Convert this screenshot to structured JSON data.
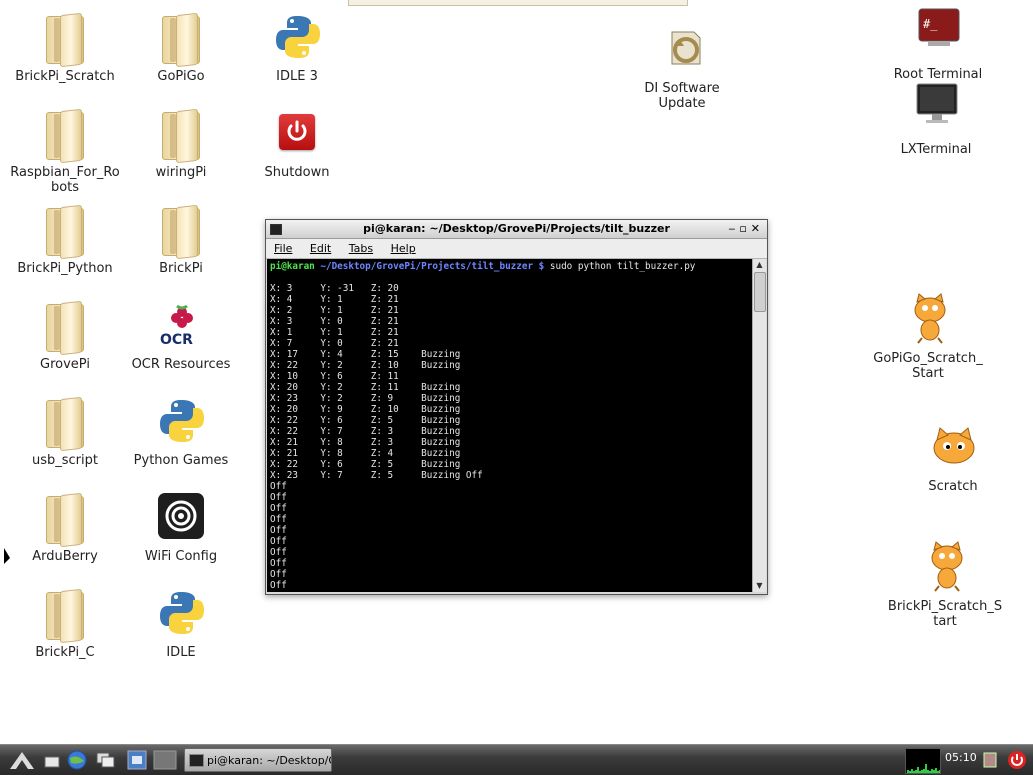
{
  "desktop": {
    "icons": [
      {
        "label": "BrickPi_Scratch",
        "type": "folder"
      },
      {
        "label": "GoPiGo",
        "type": "folder"
      },
      {
        "label": "IDLE 3",
        "type": "python"
      },
      {
        "label": "DI Software Update",
        "type": "update"
      },
      {
        "label": "Root Terminal",
        "type": "root-terminal"
      },
      {
        "label": "Raspbian_For_Robots",
        "type": "folder"
      },
      {
        "label": "wiringPi",
        "type": "folder"
      },
      {
        "label": "Shutdown",
        "type": "shutdown"
      },
      {
        "label": "LXTerminal",
        "type": "monitor"
      },
      {
        "label": "BrickPi_Python",
        "type": "folder"
      },
      {
        "label": "BrickPi",
        "type": "folder"
      },
      {
        "label": "GrovePi",
        "type": "folder"
      },
      {
        "label": "OCR Resources",
        "type": "ocr"
      },
      {
        "label": "GoPiGo_Scratch_Start",
        "type": "scratch-cat"
      },
      {
        "label": "usb_script",
        "type": "folder"
      },
      {
        "label": "Python Games",
        "type": "python"
      },
      {
        "label": "Scratch",
        "type": "scratch"
      },
      {
        "label": "ArduBerry",
        "type": "folder"
      },
      {
        "label": "WiFi Config",
        "type": "wifi"
      },
      {
        "label": "BrickPi_Scratch_Start",
        "type": "scratch-cat"
      },
      {
        "label": "BrickPi_C",
        "type": "folder"
      },
      {
        "label": "IDLE",
        "type": "python"
      }
    ]
  },
  "terminal": {
    "title": "pi@karan: ~/Desktop/GrovePi/Projects/tilt_buzzer",
    "menu": [
      "File",
      "Edit",
      "Tabs",
      "Help"
    ],
    "prompt_user": "pi@karan",
    "prompt_path": " ~/Desktop/GrovePi/Projects/tilt_buzzer $",
    "command": " sudo python tilt_buzzer.py",
    "lines": [
      "",
      "X: 3     Y: -31   Z: 20",
      "X: 4     Y: 1     Z: 21",
      "X: 2     Y: 1     Z: 21",
      "X: 3     Y: 0     Z: 21",
      "X: 1     Y: 1     Z: 21",
      "X: 7     Y: 0     Z: 21",
      "X: 17    Y: 4     Z: 15    Buzzing",
      "X: 22    Y: 2     Z: 10    Buzzing",
      "X: 10    Y: 6     Z: 11",
      "X: 20    Y: 2     Z: 11    Buzzing",
      "X: 23    Y: 2     Z: 9     Buzzing",
      "X: 20    Y: 9     Z: 10    Buzzing",
      "X: 22    Y: 6     Z: 5     Buzzing",
      "X: 22    Y: 7     Z: 3     Buzzing",
      "X: 21    Y: 8     Z: 3     Buzzing",
      "X: 21    Y: 8     Z: 4     Buzzing",
      "X: 22    Y: 6     Z: 5     Buzzing",
      "X: 23    Y: 7     Z: 5     Buzzing Off",
      "Off",
      "Off",
      "Off",
      "Off",
      "Off",
      "Off",
      "Off",
      "Off",
      "Off",
      "Off"
    ]
  },
  "taskbar": {
    "task_label": "pi@karan: ~/Desktop/G...",
    "clock": "05:10"
  }
}
